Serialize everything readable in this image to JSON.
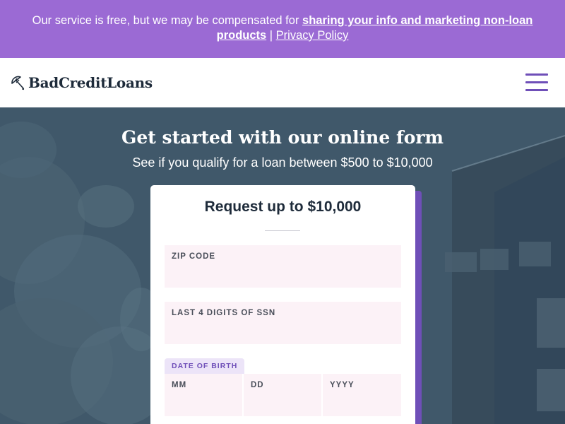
{
  "banner": {
    "text": "Our service is free, but we may be compensated for ",
    "link_bold": "sharing your info and marketing non-loan products",
    "separator": " | ",
    "privacy_link": "Privacy Policy"
  },
  "header": {
    "logo_text": "BadCreditLoans",
    "logo_icon": "umbrella-icon",
    "menu_icon": "hamburger-menu-icon"
  },
  "hero": {
    "title": "Get started with our online form",
    "subtitle": "See if you qualify for a loan between $500 to $10,000"
  },
  "form": {
    "title": "Request up to $10,000",
    "zip_label": "ZIP CODE",
    "ssn_label": "LAST 4 DIGITS OF SSN",
    "dob_label": "DATE OF BIRTH",
    "mm_label": "MM",
    "dd_label": "DD",
    "yyyy_label": "YYYY"
  },
  "colors": {
    "banner": "#9b6ad4",
    "accent": "#6f4fb8",
    "field_bg": "#fcf2f7",
    "dark_text": "#1e2b3a"
  }
}
